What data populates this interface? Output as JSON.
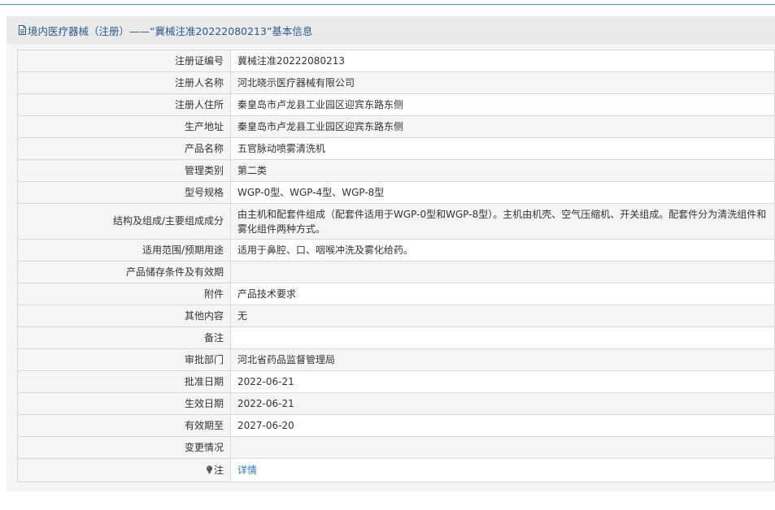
{
  "header": {
    "title": "境内医疗器械（注册）——“冀械注准20222080213”基本信息",
    "icon": "document-icon"
  },
  "rows": [
    {
      "label": "注册证编号",
      "value": "冀械注准20222080213"
    },
    {
      "label": "注册人名称",
      "value": "河北晓示医疗器械有限公司"
    },
    {
      "label": "注册人住所",
      "value": "秦皇岛市卢龙县工业园区迎宾东路东侧"
    },
    {
      "label": "生产地址",
      "value": "秦皇岛市卢龙县工业园区迎宾东路东侧"
    },
    {
      "label": "产品名称",
      "value": "五官脉动喷雾清洗机"
    },
    {
      "label": "管理类别",
      "value": "第二类"
    },
    {
      "label": "型号规格",
      "value": "WGP-0型、WGP-4型、WGP-8型"
    },
    {
      "label": "结构及组成/主要组成成分",
      "value": "由主机和配套件组成（配套件适用于WGP-0型和WGP-8型）。主机由机壳、空气压缩机、开关组成。配套件分为清洗组件和雾化组件两种方式。"
    },
    {
      "label": "适用范围/预期用途",
      "value": "适用于鼻腔、口、咽喉冲洗及雾化给药。"
    },
    {
      "label": "产品储存条件及有效期",
      "value": ""
    },
    {
      "label": "附件",
      "value": "产品技术要求"
    },
    {
      "label": "其他内容",
      "value": "无"
    },
    {
      "label": "备注",
      "value": ""
    },
    {
      "label": "审批部门",
      "value": "河北省药品监督管理局"
    },
    {
      "label": "批准日期",
      "value": "2022-06-21"
    },
    {
      "label": "生效日期",
      "value": "2022-06-21"
    },
    {
      "label": "有效期至",
      "value": "2027-06-20"
    },
    {
      "label": "变更情况",
      "value": ""
    }
  ],
  "note_row": {
    "icon": "lightbulb-icon",
    "label": "注",
    "link_text": "详情"
  },
  "colors": {
    "title": "#2b5a8a",
    "link": "#2f78c4",
    "top_rule": "#4a8bc2"
  }
}
